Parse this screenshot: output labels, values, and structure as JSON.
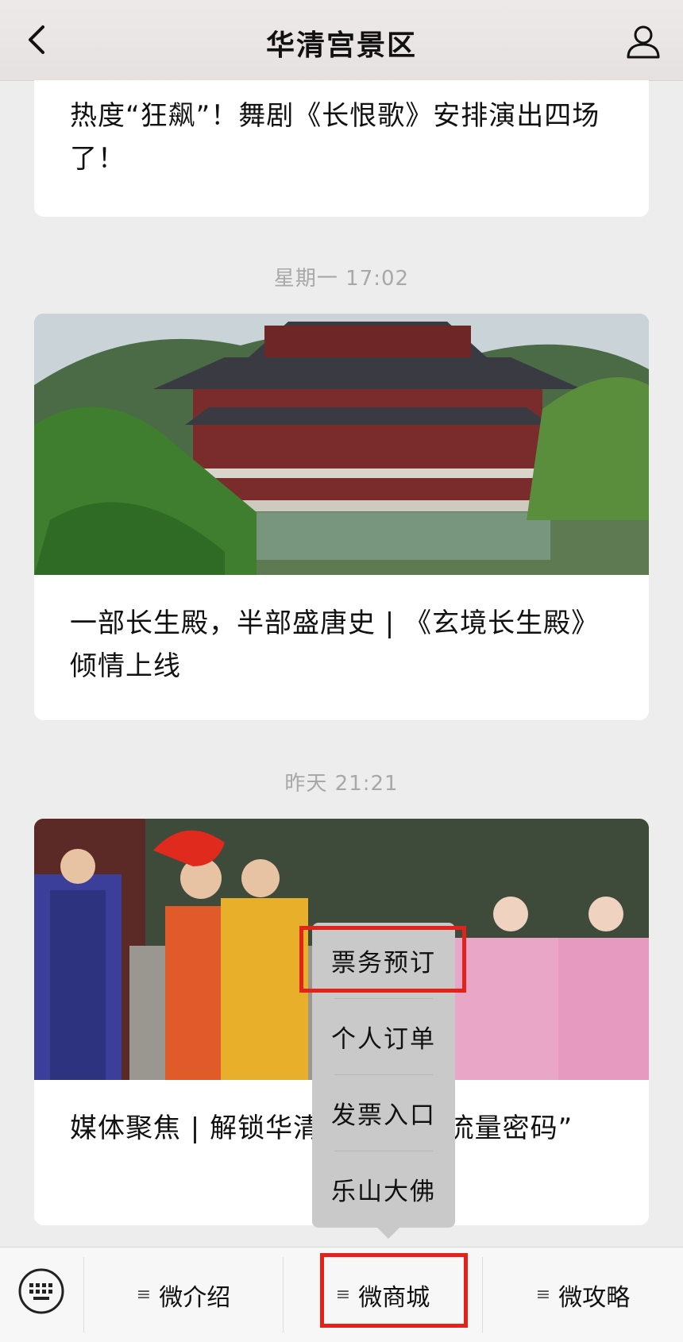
{
  "header": {
    "title": "华清宫景区",
    "back_icon": "chevron-left-icon",
    "profile_icon": "person-icon"
  },
  "feed": {
    "articles": [
      {
        "title": "热度“狂飙”！舞剧《长恨歌》安排演出四场了！"
      },
      {
        "time": "星期一 17:02",
        "title": "一部长生殿，半部盛唐史 | 《玄境长生殿》倾情上线"
      },
      {
        "time": "昨天 21:21",
        "title": "媒体聚焦 | 解锁华清宫火爆的“流量密码”"
      }
    ]
  },
  "popup_menu": {
    "items": [
      "票务预订",
      "个人订单",
      "发票入口",
      "乐山大佛"
    ]
  },
  "bottom_bar": {
    "keyboard_icon": "keyboard-icon",
    "tabs": [
      {
        "label": "微介绍",
        "icon": "menu-lines-icon"
      },
      {
        "label": "微商城",
        "icon": "menu-lines-icon"
      },
      {
        "label": "微攻略",
        "icon": "menu-lines-icon"
      }
    ]
  },
  "colors": {
    "highlight": "#e3221c",
    "menu_bg": "#c9c9c9",
    "page_bg": "#ededed"
  }
}
